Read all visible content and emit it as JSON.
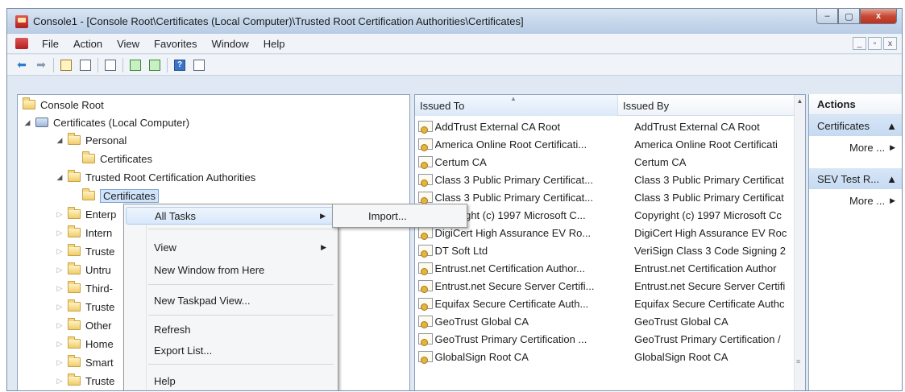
{
  "window": {
    "title": "Console1 - [Console Root\\Certificates (Local Computer)\\Trusted Root Certification Authorities\\Certificates]",
    "caption_buttons": [
      "–",
      "▢",
      "x"
    ]
  },
  "menubar": {
    "items": [
      "File",
      "Action",
      "View",
      "Favorites",
      "Window",
      "Help"
    ],
    "mdi_buttons": [
      "_",
      "▫",
      "x"
    ]
  },
  "toolbar": {
    "icons": [
      "back-arrow-icon",
      "forward-arrow-icon",
      "up-folder-icon",
      "show-hide-tree-icon",
      "new-window-icon",
      "refresh-icon",
      "export-list-icon",
      "help-icon",
      "properties-icon"
    ]
  },
  "tree": {
    "items": [
      {
        "label": "Console Root"
      },
      {
        "label": "Certificates (Local Computer)"
      },
      {
        "label": "Personal"
      },
      {
        "label": "Certificates"
      },
      {
        "label": "Trusted Root Certification Authorities"
      },
      {
        "label": "Certificates"
      },
      {
        "label": "Enterp"
      },
      {
        "label": "Intern"
      },
      {
        "label": "Truste"
      },
      {
        "label": "Untru"
      },
      {
        "label": "Third-"
      },
      {
        "label": "Truste"
      },
      {
        "label": "Other"
      },
      {
        "label": "Home"
      },
      {
        "label": "Smart"
      },
      {
        "label": "Truste"
      }
    ]
  },
  "list": {
    "columns": {
      "issued_to": "Issued To",
      "issued_by": "Issued By"
    },
    "rows": [
      {
        "issued_to": "AddTrust External CA Root",
        "issued_by": "AddTrust External CA Root"
      },
      {
        "issued_to": "America Online Root Certificati...",
        "issued_by": "America Online Root Certificati"
      },
      {
        "issued_to": "Certum CA",
        "issued_by": "Certum CA"
      },
      {
        "issued_to": "Class 3 Public Primary Certificat...",
        "issued_by": "Class 3 Public Primary Certificat"
      },
      {
        "issued_to": "Class 3 Public Primary Certificat...",
        "issued_by": "Class 3 Public Primary Certificat"
      },
      {
        "issued_to": "Copyright (c) 1997 Microsoft C...",
        "issued_by": "Copyright (c) 1997 Microsoft Cc"
      },
      {
        "issued_to": "DigiCert High Assurance EV Ro...",
        "issued_by": "DigiCert High Assurance EV Roc"
      },
      {
        "issued_to": "DT Soft Ltd",
        "issued_by": "VeriSign Class 3 Code Signing 2"
      },
      {
        "issued_to": "Entrust.net Certification Author...",
        "issued_by": "Entrust.net Certification Author"
      },
      {
        "issued_to": "Entrust.net Secure Server Certifi...",
        "issued_by": "Entrust.net Secure Server Certifi"
      },
      {
        "issued_to": "Equifax Secure Certificate Auth...",
        "issued_by": "Equifax Secure Certificate Authc"
      },
      {
        "issued_to": "GeoTrust Global CA",
        "issued_by": "GeoTrust Global CA"
      },
      {
        "issued_to": "GeoTrust Primary Certification ...",
        "issued_by": "GeoTrust Primary Certification /"
      },
      {
        "issued_to": "GlobalSign Root CA",
        "issued_by": "GlobalSign Root CA"
      }
    ]
  },
  "actions": {
    "header": "Actions",
    "sections": [
      {
        "title": "Certificates",
        "more": "More ..."
      },
      {
        "title": "SEV Test R...",
        "more": "More ..."
      }
    ]
  },
  "context_menu": {
    "items": {
      "all_tasks": "All Tasks",
      "view": "View",
      "new_window": "New Window from Here",
      "new_taskpad": "New Taskpad View...",
      "refresh": "Refresh",
      "export_list": "Export List...",
      "help": "Help"
    },
    "submenu": {
      "import": "Import..."
    }
  }
}
